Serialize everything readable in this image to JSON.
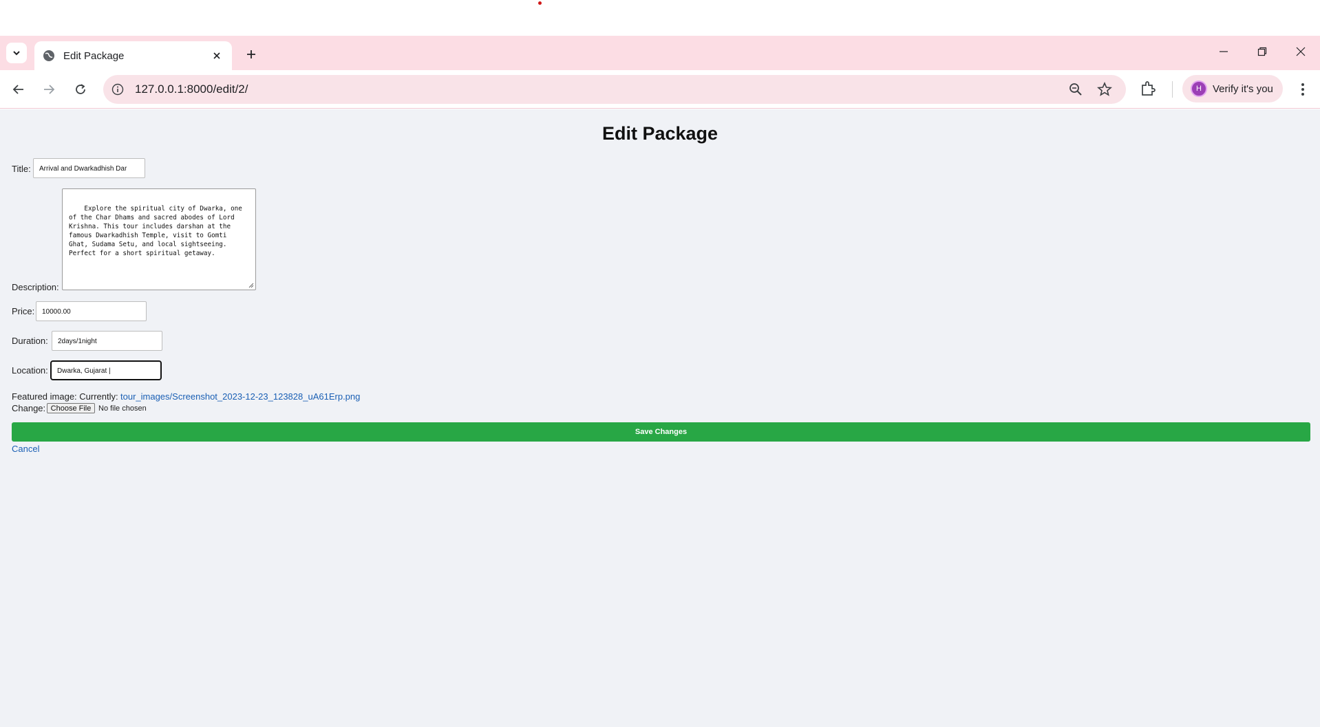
{
  "browser": {
    "tab_title": "Edit Package",
    "url": "127.0.0.1:8000/edit/2/",
    "profile_label": "Verify it's you",
    "profile_initial": "H"
  },
  "page": {
    "heading": "Edit Package",
    "title_label": "Title:",
    "title_value": "Arrival and Dwarkadhish Dar",
    "description_label": "Description:",
    "description_value": "Explore the spiritual city of Dwarka, one\nof the Char Dhams and sacred abodes of Lord\nKrishna. This tour includes darshan at the\nfamous Dwarkadhish Temple, visit to Gomti\nGhat, Sudama Setu, and local sightseeing.\nPerfect for a short spiritual getaway.",
    "price_label": "Price:",
    "price_value": "10000.00",
    "duration_label": "Duration:",
    "duration_value": "2days/1night",
    "location_label": "Location:",
    "location_value": "Dwarka,  Gujarat |",
    "featured_label": "Featured image: Currently:",
    "featured_link": "tour_images/Screenshot_2023-12-23_123828_uA61Erp.png",
    "change_label": "Change:",
    "choose_file": "Choose File",
    "no_file": "No file chosen",
    "save_button": "Save Changes",
    "cancel_link": "Cancel"
  }
}
